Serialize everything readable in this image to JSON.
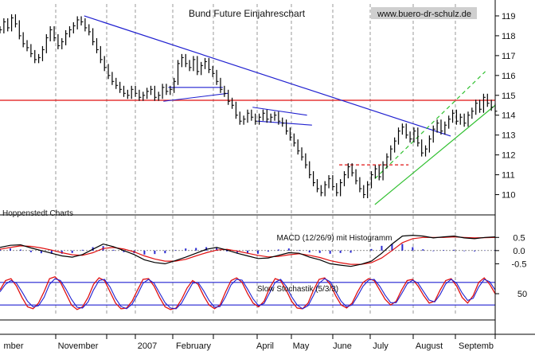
{
  "chart_data": {
    "type": "line",
    "title": "Bund Future Einjahreschart",
    "source_label": "www.buero-dr-schulz.de",
    "provider_label": "Hoppenstedt Charts",
    "x_labels": [
      "mber",
      "November",
      "2007",
      "February",
      "April",
      "May",
      "June",
      "July",
      "August",
      "Septemb"
    ],
    "main_panel": {
      "ylim": [
        109.3,
        119.6
      ],
      "yticks": [
        110,
        111,
        112,
        113,
        114,
        115,
        116,
        117,
        118,
        119
      ],
      "price_series": [
        118.3,
        118.7,
        118.4,
        118.9,
        118.6,
        118.0,
        117.6,
        117.4,
        117.1,
        116.8,
        116.9,
        117.3,
        117.9,
        118.3,
        117.9,
        117.5,
        117.7,
        118.1,
        118.3,
        118.5,
        118.8,
        118.7,
        118.4,
        118.2,
        117.7,
        117.3,
        116.8,
        116.4,
        116.0,
        115.7,
        115.5,
        115.3,
        115.1,
        115.0,
        115.3,
        115.1,
        114.9,
        115.0,
        115.2,
        115.3,
        114.9,
        115.0,
        115.4,
        115.2,
        115.3,
        115.7,
        116.6,
        116.9,
        116.6,
        116.4,
        116.8,
        116.2,
        116.5,
        116.7,
        116.3,
        116.1,
        115.7,
        115.3,
        115.1,
        114.7,
        114.5,
        114.0,
        113.7,
        113.8,
        114.1,
        113.9,
        113.7,
        113.9,
        114.1,
        113.8,
        113.9,
        114.0,
        113.7,
        113.6,
        113.2,
        112.9,
        112.6,
        112.2,
        111.9,
        111.5,
        111.0,
        110.6,
        110.3,
        110.1,
        110.5,
        110.8,
        110.4,
        110.1,
        110.6,
        111.0,
        111.4,
        111.1,
        110.7,
        110.3,
        110.0,
        110.5,
        111.0,
        111.3,
        110.9,
        111.5,
        111.9,
        112.3,
        112.7,
        113.2,
        113.4,
        113.0,
        112.8,
        113.2,
        112.6,
        112.1,
        112.3,
        112.8,
        113.3,
        113.6,
        113.2,
        113.5,
        113.8,
        114.1,
        113.7,
        113.9,
        113.6,
        114.0,
        114.2,
        114.6,
        114.3,
        114.9,
        114.6,
        114.4,
        114.2
      ],
      "horizontal_level": 114.75,
      "downtrend_line": {
        "from": [
          0.17,
          119.0
        ],
        "to": [
          0.91,
          112.95
        ]
      },
      "uptrend_line": {
        "from": [
          0.757,
          109.5
        ],
        "to": [
          1.0,
          114.5
        ]
      },
      "uptrend_parallel": {
        "from": [
          0.757,
          110.8
        ],
        "to": [
          0.98,
          116.2
        ]
      },
      "support_level_dashed": {
        "from": [
          0.685,
          111.5
        ],
        "to": [
          0.825,
          111.5
        ]
      },
      "pattern_lines": [
        {
          "from": [
            0.34,
            115.4
          ],
          "to": [
            0.45,
            115.4
          ]
        },
        {
          "from": [
            0.33,
            114.7
          ],
          "to": [
            0.46,
            115.1
          ]
        },
        {
          "from": [
            0.51,
            114.4
          ],
          "to": [
            0.62,
            114.0
          ]
        },
        {
          "from": [
            0.52,
            113.7
          ],
          "to": [
            0.63,
            113.5
          ]
        }
      ]
    },
    "macd_panel": {
      "label": "MACD (12/26/9) mit Histogramm",
      "ylim": [
        -0.85,
        0.75
      ],
      "yticks": [
        0.5,
        0.0,
        -0.5
      ],
      "ytick_labels": [
        "0.5",
        "0.0",
        "-0.5"
      ],
      "macd": [
        0.12,
        0.2,
        0.22,
        0.1,
        0.0,
        -0.1,
        -0.2,
        -0.25,
        -0.15,
        0.05,
        0.25,
        0.15,
        0.0,
        -0.15,
        -0.35,
        -0.45,
        -0.5,
        -0.38,
        -0.25,
        -0.1,
        0.05,
        0.12,
        0.02,
        -0.1,
        -0.2,
        -0.3,
        -0.28,
        -0.18,
        -0.08,
        -0.1,
        -0.25,
        -0.35,
        -0.5,
        -0.55,
        -0.6,
        -0.52,
        -0.4,
        -0.1,
        0.25,
        0.55,
        0.58,
        0.55,
        0.48,
        0.52,
        0.55,
        0.48,
        0.45,
        0.5,
        0.52
      ],
      "signal": [
        0.05,
        0.12,
        0.18,
        0.16,
        0.1,
        0.02,
        -0.08,
        -0.16,
        -0.18,
        -0.08,
        0.08,
        0.12,
        0.06,
        -0.05,
        -0.2,
        -0.32,
        -0.4,
        -0.4,
        -0.33,
        -0.2,
        -0.08,
        0.02,
        0.05,
        -0.02,
        -0.1,
        -0.18,
        -0.24,
        -0.22,
        -0.16,
        -0.12,
        -0.18,
        -0.26,
        -0.38,
        -0.46,
        -0.52,
        -0.52,
        -0.46,
        -0.28,
        0.0,
        0.3,
        0.45,
        0.5,
        0.5,
        0.5,
        0.52,
        0.5,
        0.48,
        0.49,
        0.5
      ],
      "histogram": [
        0.07,
        0.08,
        0.04,
        -0.06,
        -0.1,
        -0.12,
        -0.12,
        -0.09,
        0.03,
        0.13,
        0.17,
        0.03,
        -0.06,
        -0.1,
        -0.15,
        -0.13,
        -0.1,
        0.02,
        0.08,
        0.1,
        0.13,
        0.1,
        -0.03,
        -0.08,
        -0.1,
        -0.12,
        -0.04,
        0.04,
        0.08,
        0.02,
        -0.07,
        -0.09,
        -0.12,
        -0.09,
        -0.08,
        0.0,
        0.06,
        0.18,
        0.25,
        0.25,
        0.13,
        0.05,
        -0.02,
        0.02,
        0.03,
        -0.02,
        -0.03,
        0.01,
        0.02
      ]
    },
    "stochastic_panel": {
      "label": "Slow Stochastik (5/3/3)",
      "ylim": [
        -5,
        105
      ],
      "yticks": [
        50
      ],
      "ytick_labels": [
        "50"
      ],
      "reference_lines": [
        80,
        20
      ],
      "k": [
        60,
        85,
        90,
        70,
        40,
        15,
        10,
        25,
        55,
        90,
        95,
        80,
        50,
        20,
        8,
        15,
        40,
        75,
        92,
        85,
        55,
        25,
        10,
        12,
        30,
        60,
        88,
        90,
        70,
        40,
        15,
        8,
        12,
        35,
        65,
        85,
        75,
        45,
        20,
        10,
        20,
        55,
        85,
        92,
        80,
        50,
        25,
        15,
        30,
        65,
        90,
        85,
        60,
        30,
        12,
        10,
        25,
        60,
        88,
        92,
        75,
        45,
        20,
        12,
        25,
        55,
        80,
        90,
        85,
        60,
        35,
        20,
        30,
        60,
        85,
        88,
        70,
        45,
        25,
        30,
        60,
        85,
        90,
        70,
        40,
        25,
        45,
        80,
        92,
        75,
        50
      ],
      "d": [
        55,
        75,
        85,
        78,
        55,
        30,
        15,
        18,
        40,
        75,
        90,
        85,
        62,
        35,
        14,
        12,
        28,
        60,
        85,
        88,
        68,
        38,
        16,
        10,
        22,
        48,
        78,
        88,
        78,
        52,
        26,
        12,
        10,
        25,
        52,
        78,
        80,
        58,
        32,
        14,
        16,
        42,
        74,
        88,
        86,
        62,
        36,
        18,
        24,
        52,
        80,
        88,
        70,
        42,
        20,
        10,
        18,
        46,
        78,
        90,
        82,
        56,
        30,
        15,
        20,
        44,
        70,
        86,
        88,
        70,
        46,
        26,
        26,
        50,
        76,
        86,
        78,
        55,
        33,
        28,
        48,
        76,
        88,
        78,
        52,
        32,
        38,
        68,
        88,
        82,
        60
      ]
    }
  }
}
